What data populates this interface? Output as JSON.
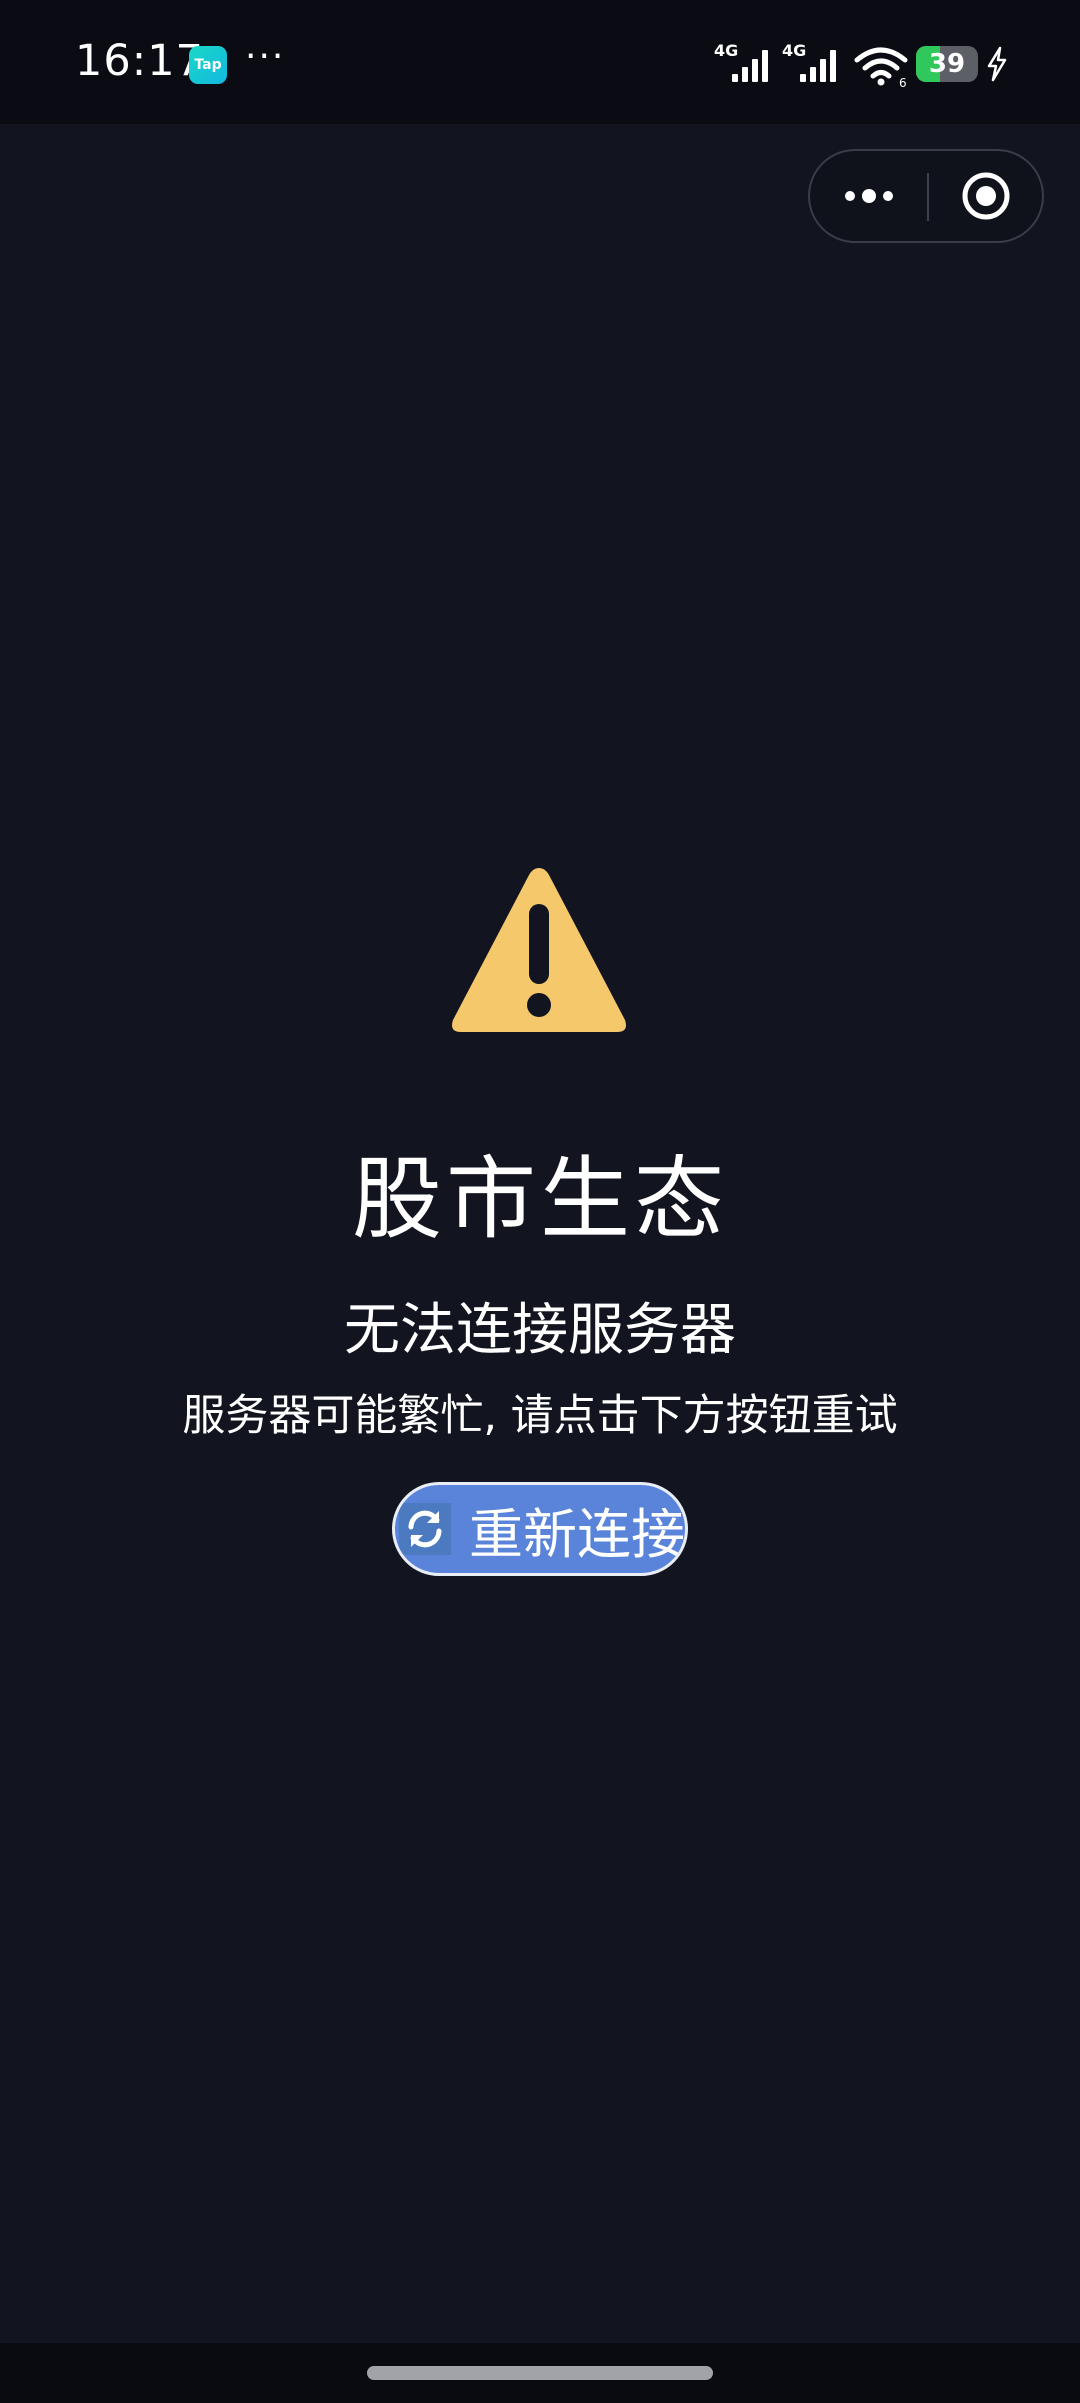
{
  "status_bar": {
    "time": "16:17",
    "tap_badge": "Tap",
    "more_indicator": "···",
    "network_1": "4G",
    "network_2": "4G",
    "battery_level": "39",
    "battery_fraction": 0.39,
    "icons": [
      "tap-app-icon",
      "signal-icon",
      "wifi-icon",
      "battery-icon",
      "charging-icon"
    ]
  },
  "capsule": {
    "icons": [
      "more-icon",
      "close-target-icon"
    ]
  },
  "error": {
    "icon": "warning-icon",
    "icon_color": "#f5c96b",
    "app_name": "股市生态",
    "title": "无法连接服务器",
    "description": "服务器可能繁忙, 请点击下方按钮重试"
  },
  "retry_button": {
    "label": "重新连接",
    "icon": "refresh-icon",
    "color": "#5a84d9"
  },
  "colors": {
    "background": "#12141f",
    "status_bar": "#0b0c13",
    "battery_green": "#30c85a"
  }
}
